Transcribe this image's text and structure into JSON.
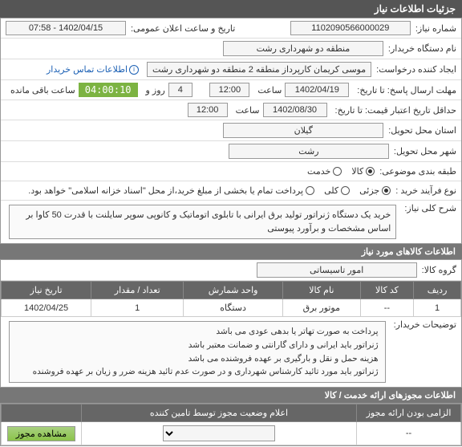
{
  "header": {
    "title": "جزئیات اطلاعات نیاز"
  },
  "fields": {
    "need_no_label": "شماره نیاز:",
    "need_no": "1102090566000029",
    "announce_label": "تاریخ و ساعت اعلان عمومی:",
    "announce": "1402/04/15 - 07:58",
    "buyer_org_label": "نام دستگاه خریدار:",
    "buyer_org": "منطقه دو شهرداری رشت",
    "requester_label": "ایجاد کننده درخواست:",
    "requester": "موسی کریمان کارپرداز منطقه 2 منطقه دو شهرداری رشت",
    "contact": "اطلاعات تماس خریدار",
    "reply_deadline_label": "مهلت ارسال پاسخ: تا تاریخ:",
    "reply_date": "1402/04/19",
    "hour_label": "ساعت",
    "reply_hour": "12:00",
    "day_label": "روز و",
    "days": "4",
    "remaining_label": "ساعت باقی مانده",
    "countdown": "04:00:10",
    "price_valid_label": "حداقل تاریخ اعتبار قیمت: تا تاریخ:",
    "price_date": "1402/08/30",
    "price_hour": "12:00",
    "province_label": "استان محل تحویل:",
    "province": "گیلان",
    "city_label": "شهر محل تحویل:",
    "city": "رشت",
    "category_label": "طبقه بندی موضوعی:",
    "cat_goods": "کالا",
    "cat_service": "خدمت",
    "purchase_type_label": "نوع فرآیند خرید :",
    "pt_partial": "جزئی",
    "pt_total": "کلی",
    "pt_note": "پرداخت تمام یا بخشی از مبلغ خرید،از محل \"اسناد خزانه اسلامی\" خواهد بود.",
    "general_desc_label": "شرح کلی نیاز:",
    "general_desc": "خرید یک دستگاه ژنراتور تولید برق ایرانی با تابلوی اتوماتیک و کانوپی سوپر سایلنت با قدرت 50 کاوا بر اساس مشخصات و برآورد پیوستی"
  },
  "goods_section": {
    "title": "اطلاعات کالاهای مورد نیاز",
    "group_label": "گروه کالا:",
    "group": "امور تاسیساتی",
    "columns": {
      "row": "ردیف",
      "code": "کد کالا",
      "name": "نام کالا",
      "unit": "واحد شمارش",
      "qty": "تعداد / مقدار",
      "date": "تاریخ نیاز"
    },
    "rows": [
      {
        "row": "1",
        "code": "--",
        "name": "موتور برق",
        "unit": "دستگاه",
        "qty": "1",
        "date": "1402/04/25"
      }
    ],
    "notes_label": "توضیحات خریدار:",
    "notes": [
      "پرداخت به صورت تهاتر یا بدهی عودی می باشد",
      "ژنراتور باید ایرانی و دارای گارانتی و ضمانت معتبر باشد",
      "هزینه حمل و نقل و بارگیری بر عهده فروشنده می باشد",
      "ژنراتور باید مورد تائید کارشناس شهرداری و در صورت عدم تائید هزینه ضرر و زیان بر عهده فروشنده"
    ]
  },
  "permits_section": {
    "title": "اطلاعات مجوزهای ارائه خدمت / کالا",
    "columns": {
      "mandatory": "الزامی بودن ارائه مجوز",
      "status": "اعلام وضعیت مجوز توسط تامین کننده",
      "blank": ""
    },
    "row": {
      "mandatory": "--",
      "status_placeholder": "",
      "btn": "مشاهده مجوز"
    }
  }
}
